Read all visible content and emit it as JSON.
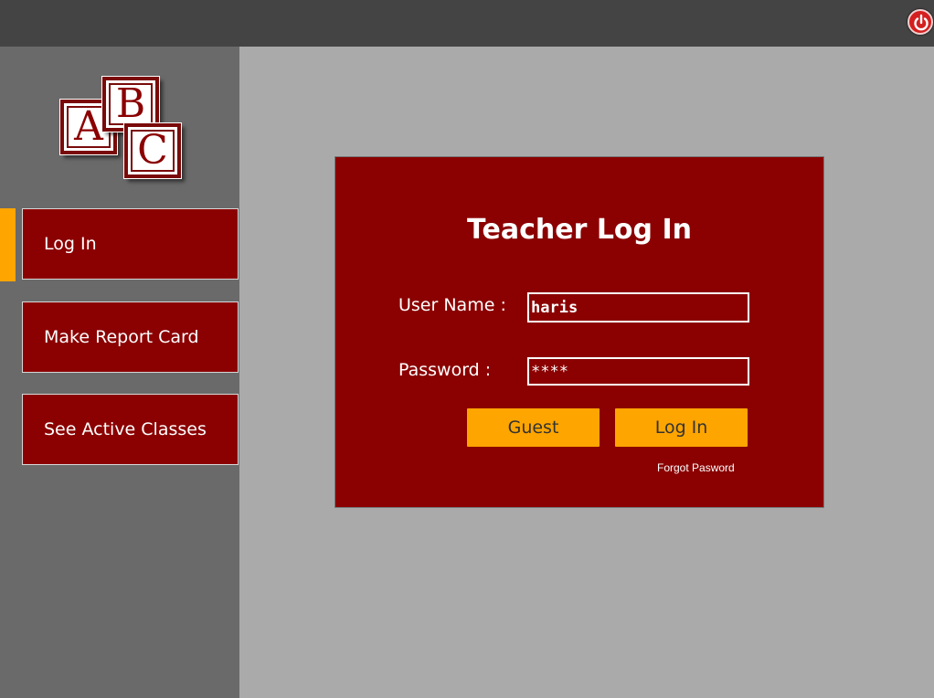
{
  "topbar": {
    "power_icon": "power-icon",
    "power_color": "#d42020"
  },
  "logo": {
    "letters": [
      "A",
      "B",
      "C"
    ]
  },
  "sidebar": {
    "active_color": "#ffa500",
    "items": [
      {
        "label": "Log In",
        "active": true
      },
      {
        "label": "Make Report Card",
        "active": false
      },
      {
        "label": "See Active Classes",
        "active": false
      }
    ]
  },
  "login": {
    "title": "Teacher Log In",
    "username_label": "User Name :",
    "username_value": "haris",
    "password_label": "Password :",
    "password_value": "****",
    "guest_button": "Guest",
    "login_button": "Log In",
    "forgot_link": "Forgot Pasword"
  },
  "colors": {
    "panel": "#8b0000",
    "accent": "#ffa500",
    "topbar": "#444444",
    "sidebar": "#6a6a6a",
    "background": "#aaaaaa"
  }
}
